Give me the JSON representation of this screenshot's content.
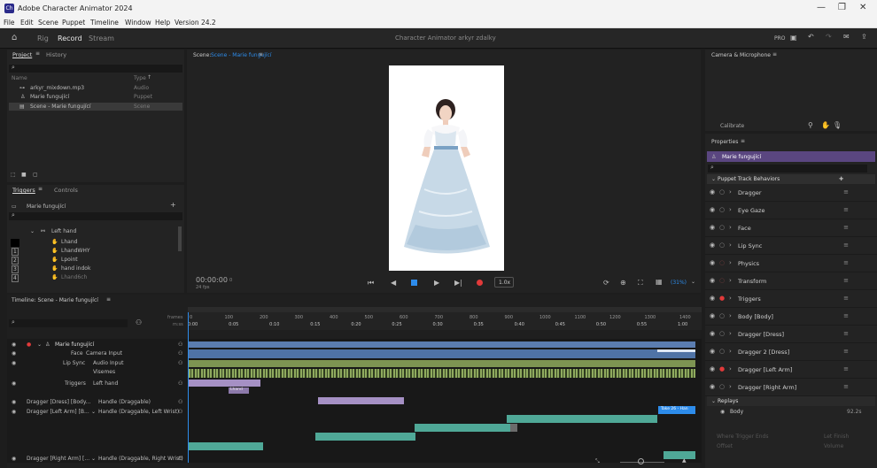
{
  "window": {
    "app_title": "Adobe Character Animator 2024",
    "app_icon_text": "Ch"
  },
  "menu": [
    "File",
    "Edit",
    "Scene",
    "Puppet",
    "Timeline",
    "Window",
    "Help",
    "Version 24.2"
  ],
  "modes": {
    "rig": "Rig",
    "record": "Record",
    "stream": "Stream",
    "center_title": "Character Animator arkyr zdalky"
  },
  "project": {
    "tab_project": "Project",
    "tab_history": "History",
    "col_name": "Name",
    "col_type": "Type",
    "items": [
      {
        "name": "arkyr_mixdown.mp3",
        "type": "Audio",
        "icon": "audio-icon"
      },
      {
        "name": "Marie fungující",
        "type": "Puppet",
        "icon": "puppet-icon"
      },
      {
        "name": "Scene - Marie fungující",
        "type": "Scene",
        "icon": "scene-icon"
      }
    ]
  },
  "triggers": {
    "tab_triggers": "Triggers",
    "tab_controls": "Controls",
    "puppet_name": "Marie fungující",
    "group": "Left hand",
    "items": [
      "Lhand",
      "LhandWHY",
      "Lpoint",
      "hand indok",
      "Lhand6ch"
    ],
    "keys": [
      "",
      "1",
      "2",
      "3",
      "4"
    ]
  },
  "scene": {
    "label": "Scene:",
    "name": "Scene - Marie fungující",
    "time": "00:00:00",
    "time_suffix": "0",
    "fps": "24 fps",
    "zoom_btn": "1.0x",
    "zoom_pct": "(31%)"
  },
  "timeline": {
    "title": "Timeline: Scene - Marie fungující",
    "frames_label": "frames",
    "mss_label": "m:ss",
    "ticks_frames": [
      "0",
      "100",
      "200",
      "300",
      "400",
      "500",
      "600",
      "700",
      "800",
      "900",
      "1000",
      "1100",
      "1200",
      "1300",
      "1400"
    ],
    "ticks_time": [
      "0:00",
      "0:05",
      "0:10",
      "0:15",
      "0:20",
      "0:25",
      "0:30",
      "0:35",
      "0:40",
      "0:45",
      "0:50",
      "0:55",
      "1:00"
    ],
    "tracks": [
      {
        "left": "Marie fungující",
        "right": ""
      },
      {
        "left": "Face",
        "right": "Camera Input"
      },
      {
        "left": "Lip Sync",
        "right": "Audio Input"
      },
      {
        "left": "",
        "right": "Visemes"
      },
      {
        "left": "Triggers",
        "right": "Left hand"
      },
      {
        "left": "Dragger [Dress] [Body...",
        "right": "Handle (Draggable)"
      },
      {
        "left": "Dragger [Left Arm] [B...",
        "right": "Handle (Draggable, Left Wrist)"
      },
      {
        "left": "Dragger [Right Arm] [...",
        "right": "Handle (Draggable, Right Wrist)"
      }
    ],
    "take_label_trigger": "Lhand",
    "take_label_blue": "Take 26 - Han"
  },
  "camera": {
    "title": "Camera & Microphone",
    "calibrate": "Calibrate"
  },
  "properties": {
    "title": "Properties",
    "puppet": "Marie fungující",
    "section": "Puppet Track Behaviors",
    "behaviors": [
      "Dragger",
      "Eye Gaze",
      "Face",
      "Lip Sync",
      "Physics",
      "Transform",
      "Triggers",
      "Body [Body]",
      "Dragger [Dress]",
      "Dragger 2 [Dress]",
      "Dragger [Left Arm]",
      "Dragger [Right Arm]"
    ],
    "replays": "Replays",
    "replay_item": "Body",
    "replay_value": "92.2s",
    "footer_1a": "Where Trigger Ends",
    "footer_1b": "Let Finish",
    "footer_2a": "Offset",
    "footer_2b": "Volume"
  },
  "colors": {
    "accent_blue": "#2d8ceb",
    "track_blue": "#5b7db0",
    "track_green": "#7d9452",
    "track_purple": "#a590c4",
    "track_teal": "#4fa897",
    "rec_red": "#e23a3a"
  }
}
